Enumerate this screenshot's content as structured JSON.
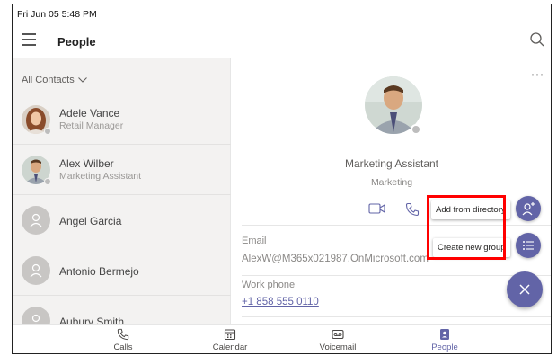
{
  "status_bar": {
    "datetime": "Fri Jun 05  5:48 PM"
  },
  "header": {
    "title": "People"
  },
  "contacts": {
    "filter_label": "All Contacts",
    "items": [
      {
        "name": "Adele Vance",
        "role": "Retail Manager",
        "avatar": "photo"
      },
      {
        "name": "Alex Wilber",
        "role": "Marketing Assistant",
        "avatar": "photo",
        "selected": true
      },
      {
        "name": "Angel Garcia",
        "role": "",
        "avatar": "generic"
      },
      {
        "name": "Antonio Bermejo",
        "role": "",
        "avatar": "generic"
      },
      {
        "name": "Aubury Smith",
        "role": "",
        "avatar": "generic"
      }
    ]
  },
  "detail": {
    "more_label": "···",
    "job_title": "Marketing Assistant",
    "department": "Marketing",
    "email_label": "Email",
    "email_value": "AlexW@M365x021987.OnMicrosoft.com",
    "work_phone_label": "Work phone",
    "work_phone_value": "+1 858 555 0110"
  },
  "fab_menu": {
    "add_from_directory": "Add from directory",
    "create_new_group": "Create new group"
  },
  "nav": [
    {
      "label": "Calls",
      "icon": "phone-icon"
    },
    {
      "label": "Calendar",
      "icon": "calendar-icon"
    },
    {
      "label": "Voicemail",
      "icon": "voicemail-icon"
    },
    {
      "label": "People",
      "icon": "people-icon",
      "active": true
    }
  ],
  "colors": {
    "accent": "#6264a7",
    "highlight": "#ff0000"
  }
}
